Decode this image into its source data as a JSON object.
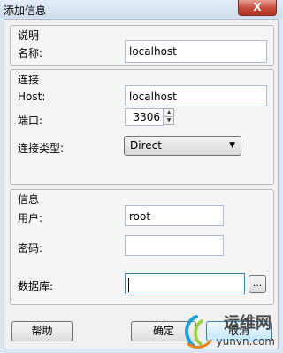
{
  "window": {
    "title": "添加信息",
    "close_label": "X"
  },
  "description_group": {
    "title": "说明",
    "name_label": "名称:",
    "name_value": "localhost"
  },
  "connection_group": {
    "title": "连接",
    "host_label": "Host:",
    "host_value": "localhost",
    "port_label": "端口:",
    "port_value": "3306",
    "type_label": "连接类型:",
    "type_value": "Direct"
  },
  "info_group": {
    "title": "信息",
    "user_label": "用户:",
    "user_value": "root",
    "password_label": "密码:",
    "password_value": "",
    "database_label": "数据库:",
    "database_value": "",
    "browse_label": "..."
  },
  "buttons": {
    "help": "帮助",
    "ok": "确定",
    "cancel": "取消"
  },
  "watermark": {
    "text": "运维网",
    "url": "yunvn.com"
  }
}
